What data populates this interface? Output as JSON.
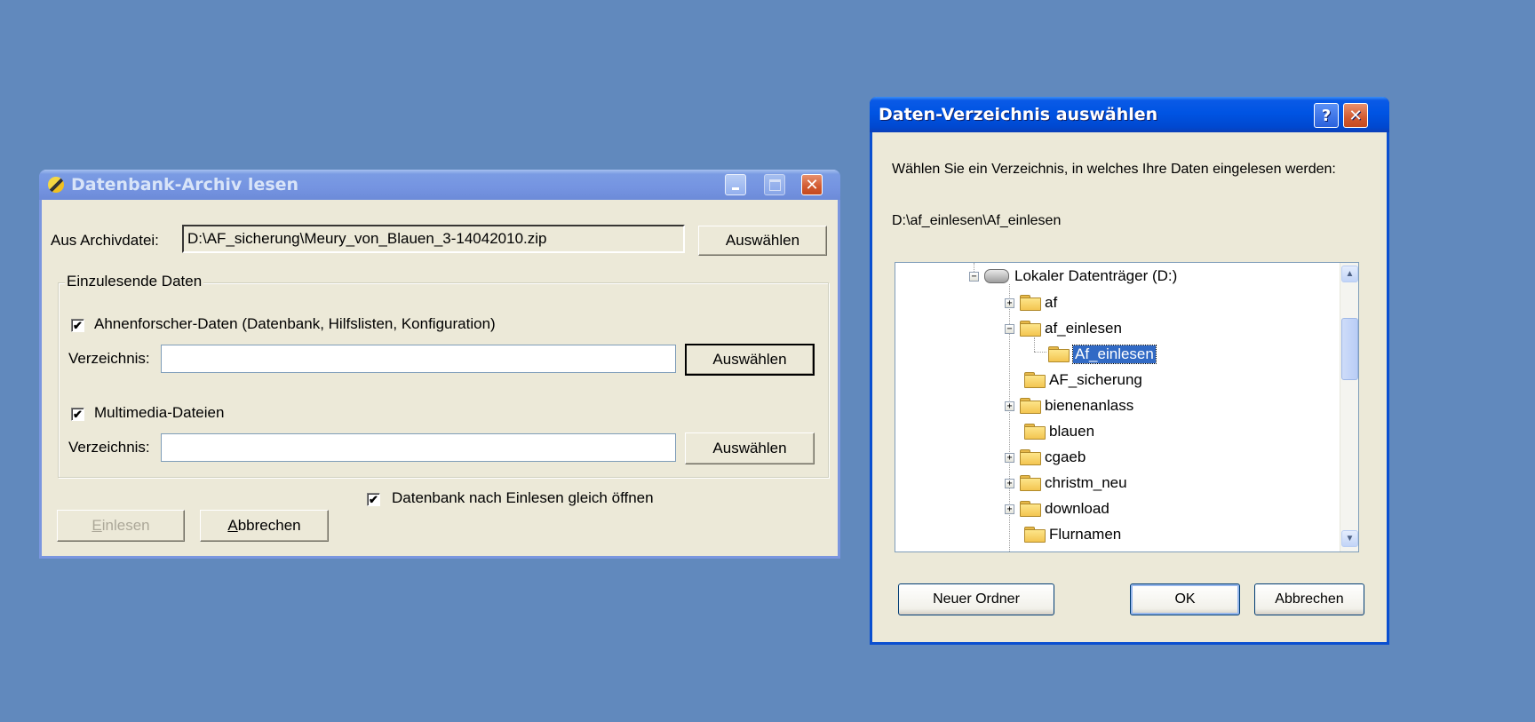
{
  "archive_dialog": {
    "title": "Datenbank-Archiv lesen",
    "archive_label": "Aus Archivdatei:",
    "archive_value": "D:\\AF_sicherung\\Meury_von_Blauen_3-14042010.zip",
    "select_label": "Auswählen",
    "group_label": "Einzulesende Daten",
    "ahnen_checkbox_label": "Ahnenforscher-Daten (Datenbank, Hilfslisten, Konfiguration)",
    "ahnen_checked": true,
    "dir_label": "Verzeichnis:",
    "dir1_value": "",
    "multimedia_checkbox_label": "Multimedia-Dateien",
    "multimedia_checked": true,
    "dir2_value": "",
    "open_checkbox_label": "Datenbank nach Einlesen gleich öffnen",
    "open_checked": true,
    "read_button_first": "E",
    "read_button_rest": "inlesen",
    "cancel_button_first": "A",
    "cancel_button_rest": "bbrechen",
    "window_controls": {
      "minimize_icon": "minimize-icon",
      "maximize_icon": "maximize-icon",
      "close_icon": "close-icon"
    }
  },
  "folder_dialog": {
    "title": "Daten-Verzeichnis auswählen",
    "help_glyph": "?",
    "close_glyph": "✕",
    "prompt": "Wählen Sie ein Verzeichnis, in welches Ihre Daten eingelesen werden:",
    "current_path": "D:\\af_einlesen\\Af_einlesen",
    "tree": {
      "drive": "Lokaler Datenträger (D:)",
      "items": [
        {
          "label": "af",
          "expander": "+"
        },
        {
          "label": "af_einlesen",
          "expander": "−"
        },
        {
          "label": "Af_einlesen",
          "expander": "",
          "selected": true
        },
        {
          "label": "AF_sicherung",
          "expander": ""
        },
        {
          "label": "bienenanlass",
          "expander": "+"
        },
        {
          "label": "blauen",
          "expander": ""
        },
        {
          "label": "cgaeb",
          "expander": "+"
        },
        {
          "label": "christm_neu",
          "expander": "+"
        },
        {
          "label": "download",
          "expander": "+"
        },
        {
          "label": "Flurnamen",
          "expander": ""
        }
      ]
    },
    "new_folder_button": "Neuer Ordner",
    "ok_button": "OK",
    "cancel_button": "Abbrechen"
  },
  "colors": {
    "desktop": "#6189bd",
    "title_active": "#0054e3",
    "title_inactive": "#7594e1",
    "dialog_face": "#ece9d8",
    "selection": "#316ac5"
  }
}
